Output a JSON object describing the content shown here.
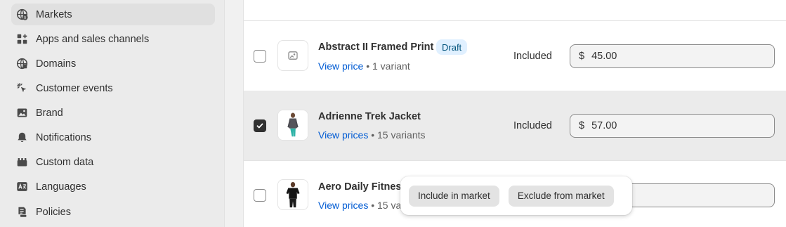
{
  "sidebar": {
    "items": [
      {
        "label": "Markets",
        "icon": "globe-dollar-icon",
        "active": true
      },
      {
        "label": "Apps and sales channels",
        "icon": "apps-icon"
      },
      {
        "label": "Domains",
        "icon": "globe-icon"
      },
      {
        "label": "Customer events",
        "icon": "cursor-click-icon"
      },
      {
        "label": "Brand",
        "icon": "image-icon"
      },
      {
        "label": "Notifications",
        "icon": "bell-icon"
      },
      {
        "label": "Custom data",
        "icon": "database-icon"
      },
      {
        "label": "Languages",
        "icon": "language-icon"
      },
      {
        "label": "Policies",
        "icon": "policy-icon"
      }
    ]
  },
  "products": [
    {
      "title": "Abstract II Framed Print",
      "badge": "Draft",
      "link": "View price",
      "variants": " • 1 variant",
      "status": "Included",
      "currency": "$",
      "price": "45.00",
      "checked": false
    },
    {
      "title": "Adrienne Trek Jacket",
      "link": "View prices",
      "variants": " • 15 variants",
      "status": "Included",
      "currency": "$",
      "price": "57.00",
      "checked": true
    },
    {
      "title": "Aero Daily Fitnes",
      "link": "View prices",
      "variants": " • 15 va",
      "checked": false
    }
  ],
  "popover": {
    "include_label": "Include in market",
    "exclude_label": "Exclude from market"
  }
}
